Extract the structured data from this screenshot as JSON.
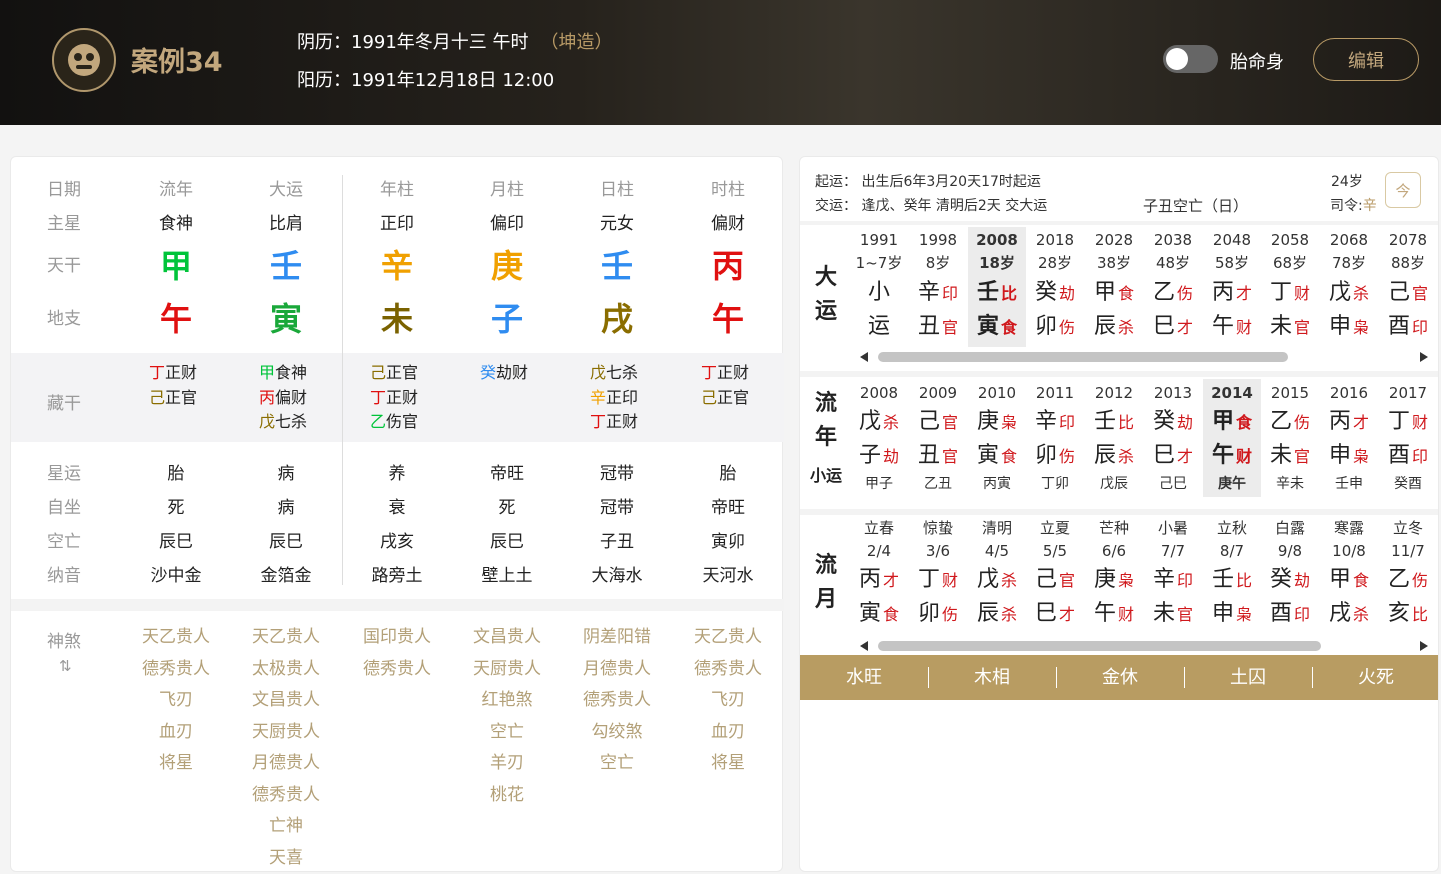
{
  "header": {
    "title": "案例34",
    "lunar_label": "阴历：1991年冬月十三 午时",
    "gender": "（坤造）",
    "solar_label": "阳历：1991年12月18日 12:00",
    "toggle_label": "胎命身",
    "toggle_on": false,
    "edit_label": "编辑"
  },
  "chart": {
    "row_labels": [
      "日期",
      "主星",
      "天干",
      "地支",
      "藏干",
      "星运",
      "自坐",
      "空亡",
      "纳音"
    ],
    "columns": [
      {
        "header": "流年",
        "main_star": "食神",
        "gan": "甲",
        "gan_color": "#00c43a",
        "zhi": "午",
        "zhi_color": "#e01010",
        "canggan": [
          {
            "c": "丁",
            "color": "#e01010",
            "t": "正财"
          },
          {
            "c": "己",
            "color": "#8a6d00",
            "t": "正官"
          }
        ],
        "xingyun": "胎",
        "zizuo": "死",
        "kongwang": "辰巳",
        "nayin": "沙中金",
        "shensha": [
          "天乙贵人",
          "德秀贵人",
          "飞刃",
          "血刃",
          "将星"
        ]
      },
      {
        "header": "大运",
        "main_star": "比肩",
        "gan": "壬",
        "gan_color": "#2f8cf0",
        "zhi": "寅",
        "zhi_color": "#1aa83a",
        "canggan": [
          {
            "c": "甲",
            "color": "#00c43a",
            "t": "食神"
          },
          {
            "c": "丙",
            "color": "#e01010",
            "t": "偏财"
          },
          {
            "c": "戊",
            "color": "#8a6d00",
            "t": "七杀"
          }
        ],
        "xingyun": "病",
        "zizuo": "病",
        "kongwang": "辰巳",
        "nayin": "金箔金",
        "shensha": [
          "天乙贵人",
          "太极贵人",
          "文昌贵人",
          "天厨贵人",
          "月德贵人",
          "德秀贵人",
          "亡神",
          "天喜"
        ]
      },
      {
        "header": "年柱",
        "main_star": "正印",
        "gan": "辛",
        "gan_color": "#f0a000",
        "zhi": "未",
        "zhi_color": "#7a6200",
        "canggan": [
          {
            "c": "己",
            "color": "#8a6d00",
            "t": "正官"
          },
          {
            "c": "丁",
            "color": "#e01010",
            "t": "正财"
          },
          {
            "c": "乙",
            "color": "#00c43a",
            "t": "伤官"
          }
        ],
        "xingyun": "养",
        "zizuo": "衰",
        "kongwang": "戌亥",
        "nayin": "路旁土",
        "shensha": [
          "国印贵人",
          "德秀贵人"
        ]
      },
      {
        "header": "月柱",
        "main_star": "偏印",
        "gan": "庚",
        "gan_color": "#f0a000",
        "zhi": "子",
        "zhi_color": "#2f8cf0",
        "canggan": [
          {
            "c": "癸",
            "color": "#2f8cf0",
            "t": "劫财"
          }
        ],
        "xingyun": "帝旺",
        "zizuo": "死",
        "kongwang": "辰巳",
        "nayin": "壁上土",
        "shensha": [
          "文昌贵人",
          "天厨贵人",
          "红艳煞",
          "空亡",
          "羊刃",
          "桃花"
        ]
      },
      {
        "header": "日柱",
        "main_star": "元女",
        "gan": "壬",
        "gan_color": "#2f8cf0",
        "zhi": "戌",
        "zhi_color": "#8a6d00",
        "canggan": [
          {
            "c": "戊",
            "color": "#8a6d00",
            "t": "七杀"
          },
          {
            "c": "辛",
            "color": "#f0a000",
            "t": "正印"
          },
          {
            "c": "丁",
            "color": "#e01010",
            "t": "正财"
          }
        ],
        "xingyun": "冠带",
        "zizuo": "冠带",
        "kongwang": "子丑",
        "nayin": "大海水",
        "shensha": [
          "阴差阳错",
          "月德贵人",
          "德秀贵人",
          "勾绞煞",
          "空亡"
        ]
      },
      {
        "header": "时柱",
        "main_star": "偏财",
        "gan": "丙",
        "gan_color": "#e01010",
        "zhi": "午",
        "zhi_color": "#e01010",
        "canggan": [
          {
            "c": "丁",
            "color": "#e01010",
            "t": "正财"
          },
          {
            "c": "己",
            "color": "#8a6d00",
            "t": "正官"
          }
        ],
        "xingyun": "胎",
        "zizuo": "帝旺",
        "kongwang": "寅卯",
        "nayin": "天河水",
        "shensha": [
          "天乙贵人",
          "德秀贵人",
          "飞刃",
          "血刃",
          "将星"
        ]
      }
    ],
    "shensha_label": "神煞",
    "shensha_toggle": "⇅",
    "column_header_date": "日期"
  },
  "yun": {
    "qiyun": "起运： 出生后6年3月20天17时起运",
    "jiaoyun": "交运： 逢戊、癸年 清明后2天 交大运",
    "kongwang": "子丑空亡（日）",
    "age": "24岁",
    "siling_prefix": "司令:",
    "siling_value": "辛",
    "cal_icon": "今",
    "dayun_label": "大运",
    "dayun": [
      {
        "y1": "1991",
        "y2": "1~7岁",
        "g": "小",
        "gs": "",
        "z": "运",
        "zs": "",
        "hl": false
      },
      {
        "y1": "1998",
        "y2": "8岁",
        "g": "辛",
        "gs": "印",
        "z": "丑",
        "zs": "官",
        "hl": false
      },
      {
        "y1": "2008",
        "y2": "18岁",
        "g": "壬",
        "gs": "比",
        "z": "寅",
        "zs": "食",
        "hl": true
      },
      {
        "y1": "2018",
        "y2": "28岁",
        "g": "癸",
        "gs": "劫",
        "z": "卯",
        "zs": "伤",
        "hl": false
      },
      {
        "y1": "2028",
        "y2": "38岁",
        "g": "甲",
        "gs": "食",
        "z": "辰",
        "zs": "杀",
        "hl": false
      },
      {
        "y1": "2038",
        "y2": "48岁",
        "g": "乙",
        "gs": "伤",
        "z": "巳",
        "zs": "才",
        "hl": false
      },
      {
        "y1": "2048",
        "y2": "58岁",
        "g": "丙",
        "gs": "才",
        "z": "午",
        "zs": "财",
        "hl": false
      },
      {
        "y1": "2058",
        "y2": "68岁",
        "g": "丁",
        "gs": "财",
        "z": "未",
        "zs": "官",
        "hl": false
      },
      {
        "y1": "2068",
        "y2": "78岁",
        "g": "戊",
        "gs": "杀",
        "z": "申",
        "zs": "枭",
        "hl": false
      },
      {
        "y1": "2078",
        "y2": "88岁",
        "g": "己",
        "gs": "官",
        "z": "酉",
        "zs": "印",
        "hl": false
      }
    ],
    "liunian_label": "流年",
    "xiaoyun_label": "小运",
    "liunian": [
      {
        "y": "2008",
        "g": "戊",
        "gs": "杀",
        "z": "子",
        "zs": "劫",
        "x": "甲子",
        "hl": false
      },
      {
        "y": "2009",
        "g": "己",
        "gs": "官",
        "z": "丑",
        "zs": "官",
        "x": "乙丑",
        "hl": false
      },
      {
        "y": "2010",
        "g": "庚",
        "gs": "枭",
        "z": "寅",
        "zs": "食",
        "x": "丙寅",
        "hl": false
      },
      {
        "y": "2011",
        "g": "辛",
        "gs": "印",
        "z": "卯",
        "zs": "伤",
        "x": "丁卯",
        "hl": false
      },
      {
        "y": "2012",
        "g": "壬",
        "gs": "比",
        "z": "辰",
        "zs": "杀",
        "x": "戊辰",
        "hl": false
      },
      {
        "y": "2013",
        "g": "癸",
        "gs": "劫",
        "z": "巳",
        "zs": "才",
        "x": "己巳",
        "hl": false
      },
      {
        "y": "2014",
        "g": "甲",
        "gs": "食",
        "z": "午",
        "zs": "财",
        "x": "庚午",
        "hl": true
      },
      {
        "y": "2015",
        "g": "乙",
        "gs": "伤",
        "z": "未",
        "zs": "官",
        "x": "辛未",
        "hl": false
      },
      {
        "y": "2016",
        "g": "丙",
        "gs": "才",
        "z": "申",
        "zs": "枭",
        "x": "壬申",
        "hl": false
      },
      {
        "y": "2017",
        "g": "丁",
        "gs": "财",
        "z": "酉",
        "zs": "印",
        "x": "癸酉",
        "hl": false
      }
    ],
    "liuyue_label": "流月",
    "liuyue": [
      {
        "t": "立春",
        "d": "2/4",
        "g": "丙",
        "gs": "才",
        "z": "寅",
        "zs": "食"
      },
      {
        "t": "惊蛰",
        "d": "3/6",
        "g": "丁",
        "gs": "财",
        "z": "卯",
        "zs": "伤"
      },
      {
        "t": "清明",
        "d": "4/5",
        "g": "戊",
        "gs": "杀",
        "z": "辰",
        "zs": "杀"
      },
      {
        "t": "立夏",
        "d": "5/5",
        "g": "己",
        "gs": "官",
        "z": "巳",
        "zs": "才"
      },
      {
        "t": "芒种",
        "d": "6/6",
        "g": "庚",
        "gs": "枭",
        "z": "午",
        "zs": "财"
      },
      {
        "t": "小暑",
        "d": "7/7",
        "g": "辛",
        "gs": "印",
        "z": "未",
        "zs": "官"
      },
      {
        "t": "立秋",
        "d": "8/7",
        "g": "壬",
        "gs": "比",
        "z": "申",
        "zs": "枭"
      },
      {
        "t": "白露",
        "d": "9/8",
        "g": "癸",
        "gs": "劫",
        "z": "酉",
        "zs": "印"
      },
      {
        "t": "寒露",
        "d": "10/8",
        "g": "甲",
        "gs": "食",
        "z": "戌",
        "zs": "杀"
      },
      {
        "t": "立冬",
        "d": "11/7",
        "g": "乙",
        "gs": "伤",
        "z": "亥",
        "zs": "比"
      }
    ],
    "elements": [
      "水旺",
      "木相",
      "金休",
      "土囚",
      "火死"
    ]
  }
}
